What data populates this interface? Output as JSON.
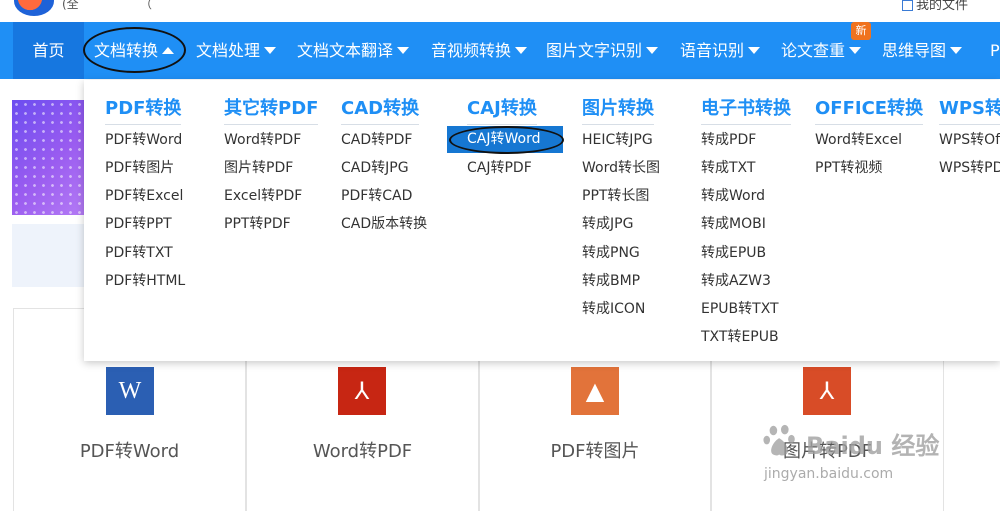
{
  "topbar": {
    "glyph_a": "(全",
    "glyph_b": "（",
    "right_text": "我的文件"
  },
  "nav": {
    "items": [
      {
        "label": "首页"
      },
      {
        "label": "文档转换"
      },
      {
        "label": "文档处理"
      },
      {
        "label": "文档文本翻译"
      },
      {
        "label": "音视频转换"
      },
      {
        "label": "图片文字识别"
      },
      {
        "label": "语音识别"
      },
      {
        "label": "论文查重"
      },
      {
        "label": "思维导图"
      },
      {
        "label": "P"
      }
    ],
    "hot_badge": "新"
  },
  "dropdown": {
    "columns": [
      {
        "title": "PDF转换",
        "items": [
          "PDF转Word",
          "PDF转图片",
          "PDF转Excel",
          "PDF转PPT",
          "PDF转TXT",
          "PDF转HTML"
        ]
      },
      {
        "title": "其它转PDF",
        "items": [
          "Word转PDF",
          "图片转PDF",
          "Excel转PDF",
          "PPT转PDF"
        ]
      },
      {
        "title": "CAD转换",
        "items": [
          "CAD转PDF",
          "CAD转JPG",
          "PDF转CAD",
          "CAD版本转换"
        ]
      },
      {
        "title": "CAJ转换",
        "items": [
          "CAJ转Word",
          "CAJ转PDF"
        ]
      },
      {
        "title": "图片转换",
        "items": [
          "HEIC转JPG",
          "Word转长图",
          "PPT转长图",
          "转成JPG",
          "转成PNG",
          "转成BMP",
          "转成ICON"
        ]
      },
      {
        "title": "电子书转换",
        "items": [
          "转成PDF",
          "转成TXT",
          "转成Word",
          "转成MOBI",
          "转成EPUB",
          "转成AZW3",
          "EPUB转TXT",
          "TXT转EPUB"
        ]
      },
      {
        "title": "OFFICE转换",
        "items": [
          "Word转Excel",
          "PPT转视频"
        ]
      },
      {
        "title": "WPS转换",
        "items": [
          "WPS转Of",
          "WPS转PD"
        ]
      }
    ]
  },
  "tools": [
    {
      "label": "PDF转Word",
      "icon": "word-icon",
      "glyph": "W",
      "color": "#2b5fb3"
    },
    {
      "label": "Word转PDF",
      "icon": "pdf-icon",
      "glyph": "⅄",
      "color": "#c72613"
    },
    {
      "label": "PDF转图片",
      "icon": "image-icon",
      "glyph": "▲",
      "color": "#e2733a"
    },
    {
      "label": "图片转PDF",
      "icon": "pdf-icon",
      "glyph": "⅄",
      "color": "#d84c27"
    }
  ],
  "watermark": {
    "title": "Baidu 经验",
    "url": "jingyan.baidu.com"
  }
}
